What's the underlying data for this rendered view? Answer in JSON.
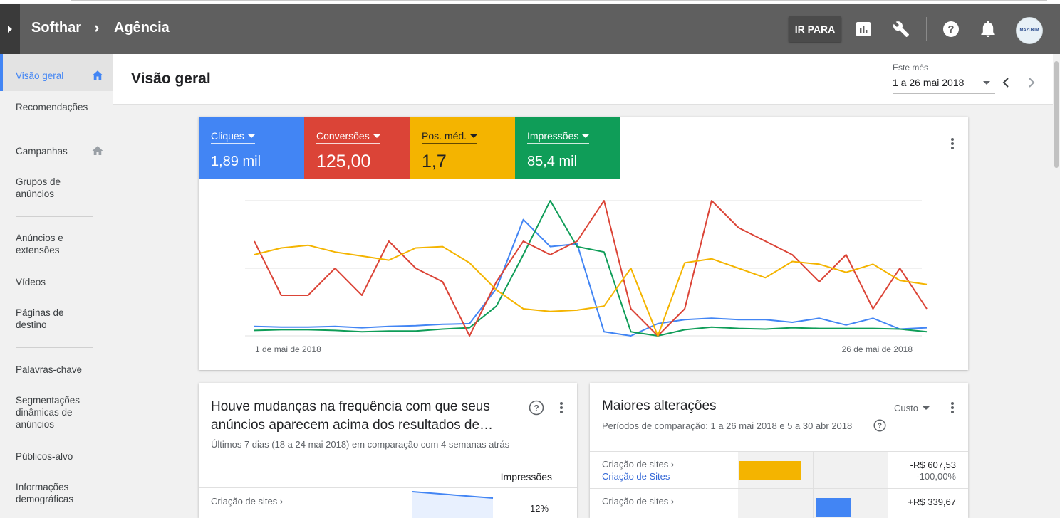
{
  "breadcrumb": {
    "account": "Softhar",
    "subaccount": "Agência"
  },
  "header": {
    "goto_label": "IR PARA",
    "avatar_text": "MAZUKIM"
  },
  "sidebar": {
    "items": [
      {
        "label": "Visão geral"
      },
      {
        "label": "Recomendações"
      },
      {
        "label": "Campanhas"
      },
      {
        "label": "Grupos de anúncios"
      },
      {
        "label": "Anúncios e extensões"
      },
      {
        "label": "Vídeos"
      },
      {
        "label": "Páginas de destino"
      },
      {
        "label": "Palavras-chave"
      },
      {
        "label": "Segmentações dinâmicas de anúncios"
      },
      {
        "label": "Públicos-alvo"
      },
      {
        "label": "Informações demográficas"
      }
    ]
  },
  "page": {
    "title": "Visão geral",
    "date_label": "Este mês",
    "date_range": "1 a 26 mai 2018"
  },
  "metrics": [
    {
      "label": "Cliques",
      "value": "1,89 mil",
      "color": "#4285f4"
    },
    {
      "label": "Conversões",
      "value": "125,00",
      "color": "#db4437"
    },
    {
      "label": "Pos. méd.",
      "value": "1,7",
      "color": "#f4b400"
    },
    {
      "label": "Impressões",
      "value": "85,4 mil",
      "color": "#0f9d58"
    }
  ],
  "chart_data": {
    "type": "line",
    "x_start_label": "1 de mai de 2018",
    "x_end_label": "26 de mai de 2018",
    "x": [
      1,
      2,
      3,
      4,
      5,
      6,
      7,
      8,
      9,
      10,
      11,
      12,
      13,
      14,
      15,
      16,
      17,
      18,
      19,
      20,
      21,
      22,
      23,
      24,
      25,
      26
    ],
    "grid": true,
    "series": [
      {
        "name": "Cliques",
        "color": "#4285f4",
        "values": [
          0.07,
          0.065,
          0.065,
          0.07,
          0.06,
          0.07,
          0.075,
          0.085,
          0.09,
          0.35,
          0.86,
          0.66,
          0.68,
          0.03,
          0.0,
          0.09,
          0.12,
          0.13,
          0.12,
          0.12,
          0.1,
          0.13,
          0.08,
          0.13,
          0.05,
          0.06
        ]
      },
      {
        "name": "Conversões",
        "color": "#db4437",
        "values": [
          0.7,
          0.3,
          0.3,
          0.5,
          0.3,
          0.7,
          0.5,
          0.4,
          0.0,
          0.4,
          0.7,
          0.6,
          0.7,
          1.0,
          0.2,
          0.0,
          0.2,
          1.0,
          0.8,
          0.7,
          0.6,
          0.4,
          0.6,
          0.2,
          0.5,
          0.2
        ]
      },
      {
        "name": "Pos. méd.",
        "color": "#f4b400",
        "values": [
          0.6,
          0.65,
          0.67,
          0.62,
          0.59,
          0.56,
          0.65,
          0.66,
          0.54,
          0.34,
          0.2,
          0.18,
          0.19,
          0.22,
          0.5,
          0.0,
          0.54,
          0.57,
          0.5,
          0.43,
          0.55,
          0.53,
          0.47,
          0.53,
          0.41,
          0.38
        ]
      },
      {
        "name": "Impressões",
        "color": "#0f9d58",
        "values": [
          0.04,
          0.045,
          0.045,
          0.04,
          0.03,
          0.035,
          0.035,
          0.05,
          0.06,
          0.22,
          0.6,
          1.0,
          0.66,
          0.62,
          0.03,
          0.0,
          0.045,
          0.065,
          0.055,
          0.05,
          0.06,
          0.055,
          0.055,
          0.055,
          0.05,
          0.03
        ]
      }
    ]
  },
  "frequency_card": {
    "title": "Houve mudanças na frequência com que seus anúncios aparecem acima dos resultados de…",
    "subtitle": "Últimos 7 dias (18 a 24 mai 2018) em comparação com 4 semanas atrás",
    "column_header": "Impressões",
    "row_label": "Criação de sites ›",
    "row_value": "12%"
  },
  "changes_card": {
    "title": "Maiores alterações",
    "subtitle": "Períodos de comparação: 1 a 26 mai 2018 e 5 a 30 abr 2018",
    "metric_select": "Custo",
    "rows": [
      {
        "campaign": "Criação de sites ›",
        "group": "Criação de Sites",
        "value": "-R$ 607,53",
        "percent": "-100,00%",
        "bar_fraction": 1.0,
        "bar_direction": "negative",
        "bar_color": "#f4b400"
      },
      {
        "campaign": "Criação de sites ›",
        "value": "+R$ 339,67",
        "bar_fraction": 0.56,
        "bar_direction": "positive",
        "bar_color": "#4285f4"
      }
    ]
  }
}
